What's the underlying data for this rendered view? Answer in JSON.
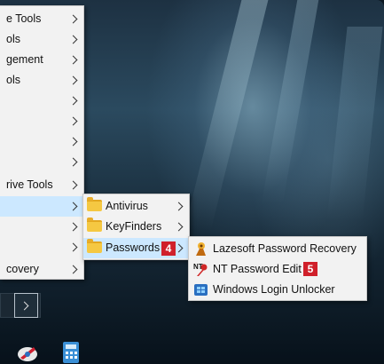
{
  "main_menu": {
    "items": [
      {
        "label": "e Tools",
        "has_submenu": true
      },
      {
        "label": "ols",
        "has_submenu": true
      },
      {
        "label": "gement",
        "has_submenu": true
      },
      {
        "label": "ols",
        "has_submenu": true
      },
      {
        "label": "",
        "has_submenu": true
      },
      {
        "label": "",
        "has_submenu": true
      },
      {
        "label": "",
        "has_submenu": true
      },
      {
        "label": "",
        "has_submenu": true
      },
      {
        "label": "rive Tools",
        "has_submenu": true
      },
      {
        "label": "",
        "has_submenu": true,
        "highlighted": true
      },
      {
        "label": "",
        "has_submenu": true
      },
      {
        "label": "",
        "has_submenu": true
      },
      {
        "label": "covery",
        "has_submenu": true
      }
    ]
  },
  "sub_menu": {
    "items": [
      {
        "label": "Antivirus",
        "icon": "folder-icon",
        "has_submenu": true
      },
      {
        "label": "KeyFinders",
        "icon": "folder-icon",
        "has_submenu": true
      },
      {
        "label": "Passwords",
        "icon": "folder-icon",
        "has_submenu": true,
        "highlighted": true,
        "badge": "4"
      }
    ]
  },
  "passwords_menu": {
    "items": [
      {
        "label": "Lazesoft Password Recovery",
        "icon": "lazesoft-icon"
      },
      {
        "label": "NT Password Edit",
        "icon": "nt-password-edit-icon",
        "badge": "5"
      },
      {
        "label": "Windows Login Unlocker",
        "icon": "windows-login-unlocker-icon"
      }
    ]
  },
  "colors": {
    "highlight": "#cce8ff",
    "badge": "#d0202a",
    "menu_bg": "#f2f2f2"
  },
  "desktop_icons": [
    "app-icon-1",
    "calculator-icon"
  ]
}
